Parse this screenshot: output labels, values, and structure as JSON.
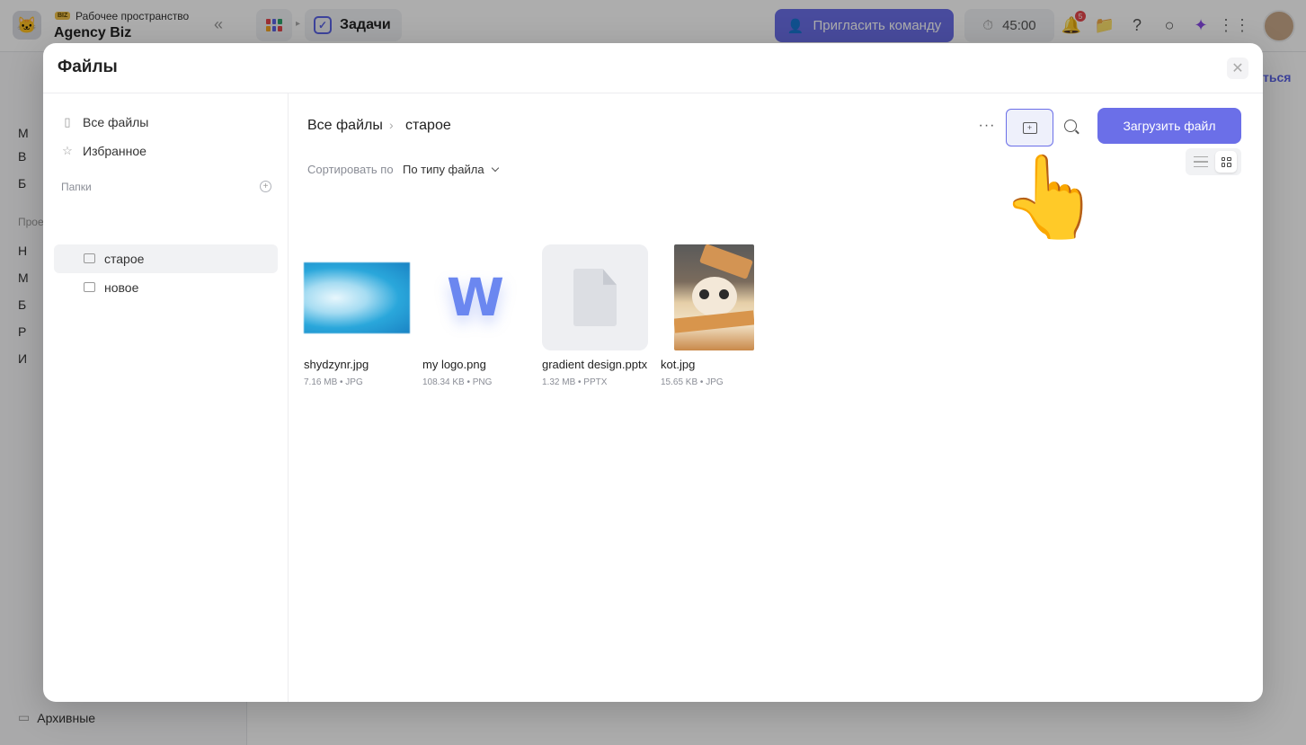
{
  "app": {
    "workspace_badge": "BIZ",
    "workspace_label": "Рабочее пространство",
    "workspace_name": "Agency Biz",
    "current_tab": "Задачи",
    "invite_label": "Пригласить команду",
    "timer": "45:00",
    "notification_count": "5",
    "archived_label": "Архивные",
    "right_peek": "ться",
    "sidebar_letters": [
      "М",
      "В",
      "Б",
      "Н",
      "М",
      "Б",
      "Р",
      "И"
    ],
    "sidebar_section": "Прое"
  },
  "modal": {
    "title": "Файлы",
    "close_icon": "close-icon",
    "sidebar": {
      "all_files": "Все файлы",
      "favorites": "Избранное",
      "folders_label": "Папки",
      "folders": [
        {
          "label": "старое",
          "active": true
        },
        {
          "label": "новое",
          "active": false
        }
      ]
    },
    "breadcrumb": {
      "root": "Все файлы",
      "current": "старое"
    },
    "upload_label": "Загрузить файл",
    "sort": {
      "label": "Сортировать по",
      "value": "По типу файла"
    },
    "files": [
      {
        "name": "shydzynr.jpg",
        "meta": "7.16 MB • JPG",
        "thumb": "blue-blur-image"
      },
      {
        "name": "my logo.png",
        "meta": "108.34 KB • PNG",
        "thumb": "w-logo-image"
      },
      {
        "name": "gradient design.pptx",
        "meta": "1.32 MB • PPTX",
        "thumb": "document-icon"
      },
      {
        "name": "kot.jpg",
        "meta": "15.65 KB • JPG",
        "thumb": "cat-photo"
      }
    ]
  },
  "colors": {
    "accent": "#6b6fe8",
    "overlay": "rgba(0,0,0,0.32)"
  }
}
